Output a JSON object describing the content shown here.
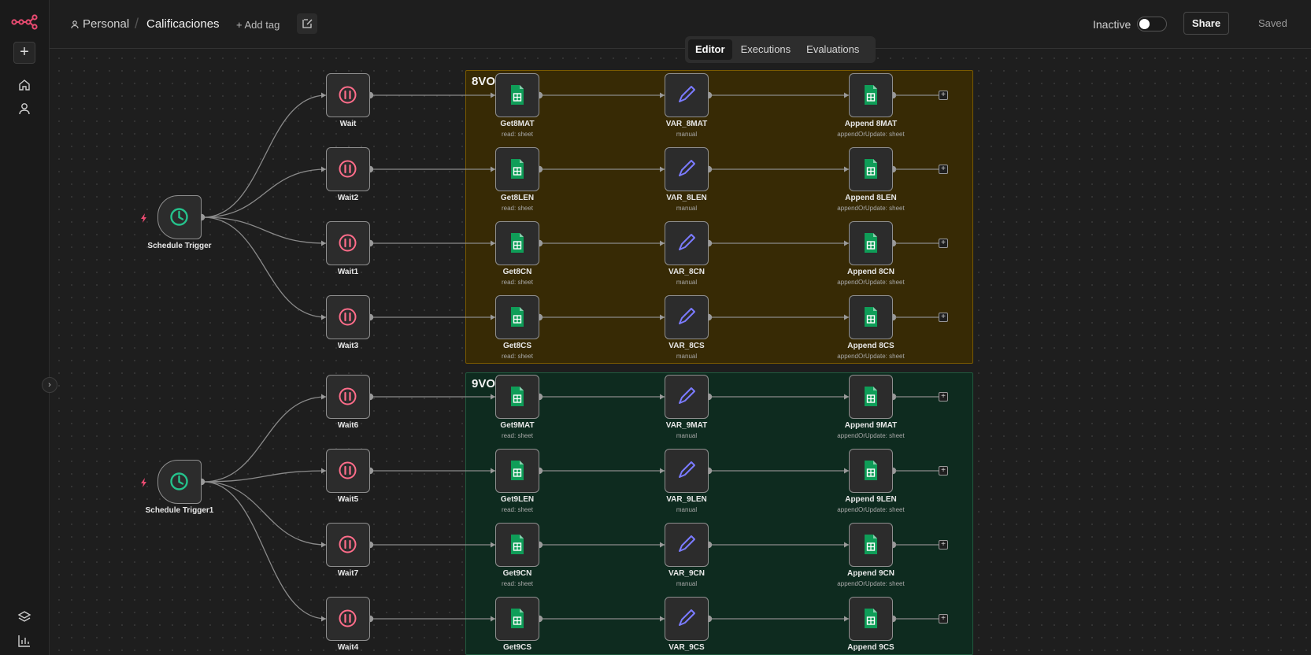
{
  "topbar": {
    "owner": "Personal",
    "separator": "/",
    "workflow_name": "Calificaciones",
    "add_tag": "+ Add tag",
    "status_label": "Inactive",
    "active": false,
    "share": "Share",
    "save_state": "Saved"
  },
  "tabs": [
    {
      "label": "Editor",
      "active": true
    },
    {
      "label": "Executions",
      "active": false
    },
    {
      "label": "Evaluations",
      "active": false
    }
  ],
  "sidebar": {
    "add_button": "+",
    "icons": [
      "n8n-logo-icon",
      "home-icon",
      "user-icon",
      "templates-icon",
      "insights-icon"
    ],
    "collapse_icon": "chevron-right-icon"
  },
  "colors": {
    "accent": "#ea4b71",
    "trigger_icon": "#25c28c",
    "wait_icon": "#ff6d8a",
    "sheets_icon": "#0f9d58",
    "set_icon": "#7b7bff",
    "sticky_8": "#372a05",
    "sticky_9": "#0e2b1f"
  },
  "groups": [
    {
      "title": "8VO",
      "trigger": {
        "label": "Schedule Trigger",
        "icon": "clock-icon"
      },
      "rows": [
        {
          "wait": "Wait",
          "get": "Get8MAT",
          "get_sub": "read: sheet",
          "set": "VAR_8MAT",
          "set_sub": "manual",
          "append": "Append 8MAT",
          "append_sub": "appendOrUpdate: sheet"
        },
        {
          "wait": "Wait2",
          "get": "Get8LEN",
          "get_sub": "read: sheet",
          "set": "VAR_8LEN",
          "set_sub": "manual",
          "append": "Append 8LEN",
          "append_sub": "appendOrUpdate: sheet"
        },
        {
          "wait": "Wait1",
          "get": "Get8CN",
          "get_sub": "read: sheet",
          "set": "VAR_8CN",
          "set_sub": "manual",
          "append": "Append 8CN",
          "append_sub": "appendOrUpdate: sheet"
        },
        {
          "wait": "Wait3",
          "get": "Get8CS",
          "get_sub": "read: sheet",
          "set": "VAR_8CS",
          "set_sub": "manual",
          "append": "Append 8CS",
          "append_sub": "appendOrUpdate: sheet"
        }
      ]
    },
    {
      "title": "9VO",
      "trigger": {
        "label": "Schedule Trigger1",
        "icon": "clock-icon"
      },
      "rows": [
        {
          "wait": "Wait6",
          "get": "Get9MAT",
          "get_sub": "read: sheet",
          "set": "VAR_9MAT",
          "set_sub": "manual",
          "append": "Append 9MAT",
          "append_sub": "appendOrUpdate: sheet"
        },
        {
          "wait": "Wait5",
          "get": "Get9LEN",
          "get_sub": "read: sheet",
          "set": "VAR_9LEN",
          "set_sub": "manual",
          "append": "Append 9LEN",
          "append_sub": "appendOrUpdate: sheet"
        },
        {
          "wait": "Wait7",
          "get": "Get9CN",
          "get_sub": "read: sheet",
          "set": "VAR_9CN",
          "set_sub": "manual",
          "append": "Append 9CN",
          "append_sub": "appendOrUpdate: sheet"
        },
        {
          "wait": "Wait4",
          "get": "Get9CS",
          "get_sub": "",
          "set": "VAR_9CS",
          "set_sub": "",
          "append": "Append 9CS",
          "append_sub": ""
        }
      ]
    }
  ]
}
